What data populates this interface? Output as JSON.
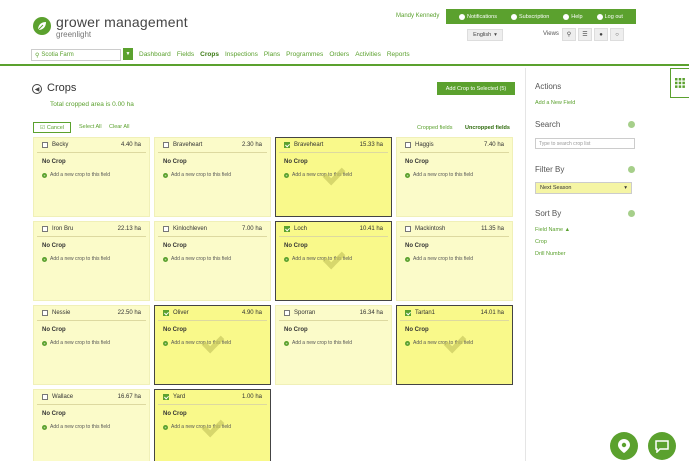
{
  "header": {
    "brand_title": "grower management",
    "brand_subtitle": "greenlight",
    "user_name": "Mandy Kennedy",
    "topbar": [
      {
        "label": "Notifications",
        "icon": "bell-icon"
      },
      {
        "label": "Subscription",
        "icon": "gear-icon"
      },
      {
        "label": "Help",
        "icon": "help-icon"
      },
      {
        "label": "Log out",
        "icon": "power-icon"
      }
    ],
    "language": "English",
    "views_label": "Views"
  },
  "nav": {
    "farm": "Scotia Farm",
    "items": [
      "Dashboard",
      "Fields",
      "Crops",
      "Inspections",
      "Plans",
      "Programmes",
      "Orders",
      "Activities",
      "Reports"
    ],
    "active": "Crops"
  },
  "main": {
    "title": "Crops",
    "total_area": "Total cropped area is 0.00 ha",
    "add_crop_button": "Add Crop to Selected (5)",
    "cancel_label": "Cancel",
    "select_all": "Select All",
    "clear_all": "Clear All",
    "cropped_fields": "Cropped fields",
    "uncropped_fields": "Uncropped fields",
    "no_crop_label": "No Crop",
    "add_new_crop_label": "Add a new crop to this field",
    "fields": [
      {
        "name": "Becky",
        "area": "4.40 ha",
        "selected": false
      },
      {
        "name": "Braveheart",
        "area": "2.30 ha",
        "selected": false
      },
      {
        "name": "Braveheart",
        "area": "15.33 ha",
        "selected": true
      },
      {
        "name": "Haggis",
        "area": "7.40 ha",
        "selected": false
      },
      {
        "name": "Iron Bru",
        "area": "22.13 ha",
        "selected": false
      },
      {
        "name": "Kinlochleven",
        "area": "7.00 ha",
        "selected": false
      },
      {
        "name": "Loch",
        "area": "10.41 ha",
        "selected": true
      },
      {
        "name": "Mackintosh",
        "area": "11.35 ha",
        "selected": false
      },
      {
        "name": "Nessie",
        "area": "22.50 ha",
        "selected": false
      },
      {
        "name": "Oliver",
        "area": "4.90 ha",
        "selected": true
      },
      {
        "name": "Sporran",
        "area": "16.34 ha",
        "selected": false
      },
      {
        "name": "Tartan1",
        "area": "14.01 ha",
        "selected": true
      },
      {
        "name": "Wallace",
        "area": "16.67 ha",
        "selected": false
      },
      {
        "name": "Yard",
        "area": "1.00 ha",
        "selected": true
      }
    ]
  },
  "sidebar": {
    "actions_title": "Actions",
    "add_new_field": "Add a New Field",
    "search_title": "Search",
    "search_placeholder": "Type to search crop list",
    "filter_title": "Filter By",
    "filter_value": "Next Season",
    "sort_title": "Sort By",
    "sort_options": [
      "Field Name ▲",
      "Crop",
      "Drill Number"
    ]
  },
  "colors": {
    "brand_green": "#5ba12e",
    "card_yellow": "#fbfbc9",
    "selected_yellow": "#f9f98a"
  }
}
